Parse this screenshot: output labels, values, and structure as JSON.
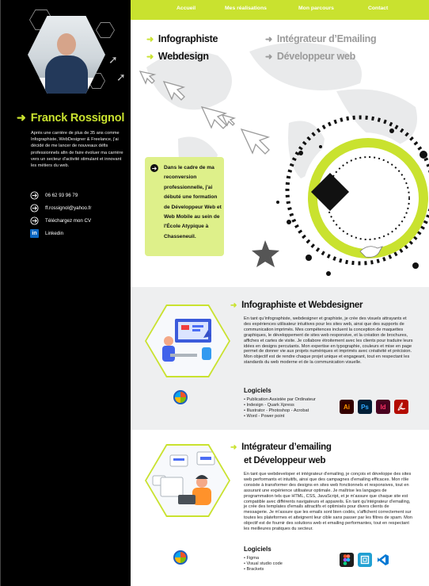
{
  "nav": {
    "items": [
      {
        "label": "Accueil"
      },
      {
        "label": "Mes réalisations"
      },
      {
        "label": "Mon parcours"
      },
      {
        "label": "Contact"
      }
    ]
  },
  "profile": {
    "name": "Franck Rossignol",
    "bio": "Après une carrière de plus de 35 ans comme Infographiste, WebDesigner & Freelance, j'ai décidé de me lancer de nouveaux défis professionnels afin de faire évoluer ma carrière vers un secteur d'activité stimulant et innovant les métiers du web.",
    "contacts": [
      {
        "icon": "arrow-right-circle-icon",
        "label": "06 62 93 96 79"
      },
      {
        "icon": "arrow-right-circle-icon",
        "label": "ff.rossignol@yahoo.fr"
      },
      {
        "icon": "arrow-right-circle-icon",
        "label": "Téléchargez mon CV"
      },
      {
        "icon": "linkedin-icon",
        "label": "Linkedin"
      }
    ]
  },
  "hero": {
    "roles": [
      {
        "label": "Infographiste",
        "style": "dark"
      },
      {
        "label": "Intégrateur d’Emailing",
        "style": "light"
      },
      {
        "label": "Webdesign",
        "style": "dark"
      },
      {
        "label": "Développeur web",
        "style": "light"
      }
    ],
    "callout": "Dans le cadre de ma reconversion professionnelle, j'ai débuté une formation de Développeur Web et Web Mobile au sein de l'École Atypique à Chasseneuil."
  },
  "sections": [
    {
      "title_line1": "Infographiste et Webdesigner",
      "title_line2": "",
      "text": "En tant qu'infographiste, webdesigner et graphiste, je crée des visuels attrayants et des expériences utilisateur intuitives pour les sites web, ainsi que des supports de communication imprimés. Mes compétences incluent la conception de maquettes graphiques, le développement de sites web responsive, et la création de brochures, affiches et cartes de visite. Je collabore étroitement avec les clients pour traduire leurs idées en designs percutants. Mon expertise en typographie, couleurs et mise en page permet de donner vie aux projets numériques et imprimés avec créativité et précision. Mon objectif est de rendre chaque projet unique et engageant, tout en respectant les standards du web moderne et de la communication visuelle.",
      "logiciels_title": "Logiciels",
      "software": [
        "Publication Assistée par Ordinateur",
        "Indesign - Quark Xpress",
        "Illustrator - Photoshop - Acrobat",
        "Word - Power point"
      ],
      "apps": [
        {
          "label": "Ai",
          "bg": "#330000",
          "fg": "#ff9a00"
        },
        {
          "label": "Ps",
          "bg": "#001e36",
          "fg": "#31a8ff"
        },
        {
          "label": "Id",
          "bg": "#49021f",
          "fg": "#ff3366"
        },
        {
          "label": "",
          "bg": "#b30b00",
          "fg": "#ffffff",
          "icon": "acrobat-icon"
        }
      ]
    },
    {
      "title_line1": "Intégrateur d’emailing",
      "title_line2": "et Développeur web",
      "text": "En tant que webdeveloper et intégrateur d'emailing, je conçois et développe des sites web performants et intuitifs, ainsi que des campagnes d'emailing efficaces. Mon rôle consiste à transformer des designs en sites web fonctionnels et responsives, tout en assurant une expérience utilisateur optimale. Je maîtrise les langages de programmation tels que HTML, CSS, JavaScript, et je m'assure que chaque site est compatible avec différents navigateurs et appareils. En tant qu'intégrateur d'emailing, je crée des templates d'emails attractifs et optimisés pour divers clients de messagerie. Je m'assure que les emails sont bien codés, s'affichent correctement sur toutes les plateformes et atteignent leur cible sans passer par les filtres de spam. Mon objectif est de fournir des solutions web et emailing performantes, tout en respectant les meilleures pratiques du secteur.",
      "logiciels_title": "Logiciels",
      "software": [
        "Figma",
        "Visual studio code",
        "Brackets"
      ],
      "apps": [
        {
          "label": "",
          "bg": "#1e1e1e",
          "fg": "#ffffff",
          "icon": "figma-icon"
        },
        {
          "label": "",
          "bg": "#21a0d2",
          "fg": "#ffffff",
          "icon": "brackets-icon"
        },
        {
          "label": "",
          "bg": "#ffffff",
          "fg": "#0078d4",
          "icon": "vscode-icon"
        }
      ]
    }
  ],
  "colors": {
    "accent": "#c9e22f",
    "sidebar": "#000000",
    "callout": "#def08a"
  }
}
